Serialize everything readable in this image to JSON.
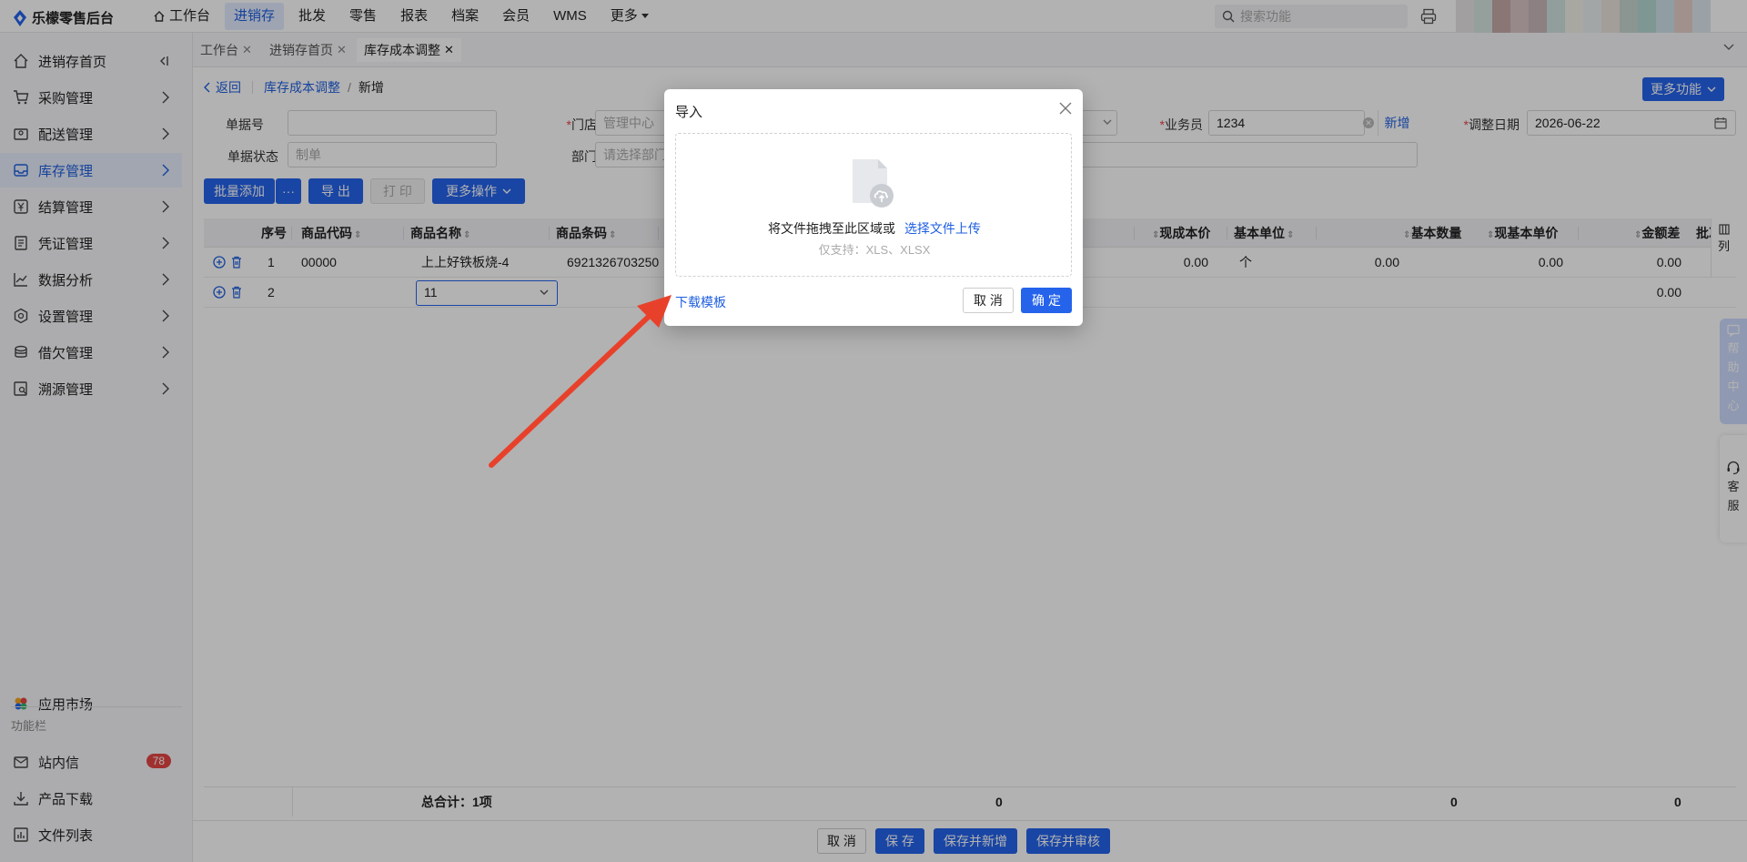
{
  "app": {
    "title": "乐檬零售后台"
  },
  "topnav": {
    "items": [
      {
        "label": "工作台"
      },
      {
        "label": "进销存"
      },
      {
        "label": "批发"
      },
      {
        "label": "零售"
      },
      {
        "label": "报表"
      },
      {
        "label": "档案"
      },
      {
        "label": "会员"
      },
      {
        "label": "WMS"
      },
      {
        "label": "更多"
      }
    ],
    "search_placeholder": "搜索功能"
  },
  "sidebar": {
    "items": [
      {
        "label": "进销存首页"
      },
      {
        "label": "采购管理"
      },
      {
        "label": "配送管理"
      },
      {
        "label": "库存管理"
      },
      {
        "label": "结算管理"
      },
      {
        "label": "凭证管理"
      },
      {
        "label": "数据分析"
      },
      {
        "label": "设置管理"
      },
      {
        "label": "借欠管理"
      },
      {
        "label": "溯源管理"
      }
    ],
    "app_market": "应用市场",
    "section_title": "功能栏",
    "bottom": [
      {
        "label": "站内信",
        "badge": "78"
      },
      {
        "label": "产品下载"
      },
      {
        "label": "文件列表"
      }
    ]
  },
  "tabs": [
    {
      "label": "工作台"
    },
    {
      "label": "进销存首页"
    },
    {
      "label": "库存成本调整"
    }
  ],
  "breadcrumb": {
    "back": "返回",
    "parent": "库存成本调整",
    "separator": "/",
    "current": "新增"
  },
  "more_functions": "更多功能",
  "form": {
    "doc_no_label": "单据号",
    "doc_no_value": "",
    "store_label": "门店",
    "store_value": "管理中心",
    "salesman_label": "业务员",
    "salesman_value": "1234",
    "salesman_add": "新增",
    "date_label": "调整日期",
    "date_value": "2026-06-22",
    "status_label": "单据状态",
    "status_value": "制单",
    "dept_label": "部门",
    "dept_placeholder": "请选择部门"
  },
  "toolbar": {
    "batch_add": "批量添加",
    "dots": "···",
    "export": "导 出",
    "print": "打 印",
    "more_ops": "更多操作"
  },
  "table": {
    "headers": {
      "seq": "序号",
      "code": "商品代码",
      "name": "商品名称",
      "barcode": "商品条码",
      "cur_cost": "现成本价",
      "unit": "基本单位",
      "qty": "基本数量",
      "cur_unit_price": "现基本单价",
      "amount_diff": "金额差",
      "batch": "批次",
      "cols": "列"
    },
    "rows": [
      {
        "seq": "1",
        "code": "00000",
        "name": "上上好铁板烧-4",
        "barcode": "6921326703250",
        "cur_cost": "0.00",
        "unit": "个",
        "qty": "0.00",
        "cur_unit_price": "0.00",
        "amount_diff": "0.00"
      },
      {
        "seq": "2",
        "code": "",
        "name": "11",
        "barcode": "",
        "cur_cost": "",
        "unit": "",
        "qty": "",
        "cur_unit_price": "",
        "amount_diff": "0.00"
      }
    ],
    "footer": {
      "total_label": "总合计：1项",
      "sum1": "0",
      "sum2": "0",
      "sum3": "0"
    }
  },
  "bottom_bar": {
    "cancel": "取 消",
    "save": "保 存",
    "save_new": "保存并新增",
    "save_audit": "保存并审核"
  },
  "modal": {
    "title": "导入",
    "drop_text": "将文件拖拽至此区域或",
    "select_link": "选择文件上传",
    "support_text": "仅支持：XLS、XLSX",
    "download_template": "下载模板",
    "cancel": "取 消",
    "ok": "确 定"
  },
  "float": {
    "help": [
      "帮",
      "助",
      "中",
      "心"
    ],
    "service": [
      "客",
      "服"
    ]
  },
  "colors": {
    "primary": "#2563eb",
    "arrow": "#e8412b",
    "badge": "#e64545"
  }
}
